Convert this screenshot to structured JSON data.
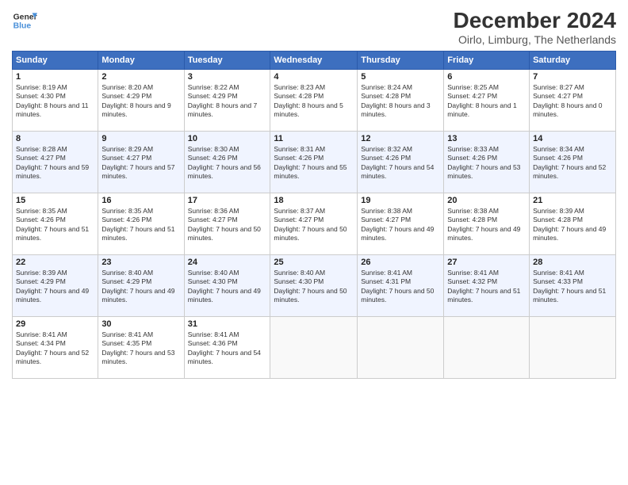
{
  "header": {
    "logo_line1": "General",
    "logo_line2": "Blue",
    "month": "December 2024",
    "location": "Oirlo, Limburg, The Netherlands"
  },
  "weekdays": [
    "Sunday",
    "Monday",
    "Tuesday",
    "Wednesday",
    "Thursday",
    "Friday",
    "Saturday"
  ],
  "weeks": [
    [
      {
        "day": "1",
        "rise": "8:19 AM",
        "set": "4:30 PM",
        "daylight": "8 hours and 11 minutes."
      },
      {
        "day": "2",
        "rise": "8:20 AM",
        "set": "4:29 PM",
        "daylight": "8 hours and 9 minutes."
      },
      {
        "day": "3",
        "rise": "8:22 AM",
        "set": "4:29 PM",
        "daylight": "8 hours and 7 minutes."
      },
      {
        "day": "4",
        "rise": "8:23 AM",
        "set": "4:28 PM",
        "daylight": "8 hours and 5 minutes."
      },
      {
        "day": "5",
        "rise": "8:24 AM",
        "set": "4:28 PM",
        "daylight": "8 hours and 3 minutes."
      },
      {
        "day": "6",
        "rise": "8:25 AM",
        "set": "4:27 PM",
        "daylight": "8 hours and 1 minute."
      },
      {
        "day": "7",
        "rise": "8:27 AM",
        "set": "4:27 PM",
        "daylight": "8 hours and 0 minutes."
      }
    ],
    [
      {
        "day": "8",
        "rise": "8:28 AM",
        "set": "4:27 PM",
        "daylight": "7 hours and 59 minutes."
      },
      {
        "day": "9",
        "rise": "8:29 AM",
        "set": "4:27 PM",
        "daylight": "7 hours and 57 minutes."
      },
      {
        "day": "10",
        "rise": "8:30 AM",
        "set": "4:26 PM",
        "daylight": "7 hours and 56 minutes."
      },
      {
        "day": "11",
        "rise": "8:31 AM",
        "set": "4:26 PM",
        "daylight": "7 hours and 55 minutes."
      },
      {
        "day": "12",
        "rise": "8:32 AM",
        "set": "4:26 PM",
        "daylight": "7 hours and 54 minutes."
      },
      {
        "day": "13",
        "rise": "8:33 AM",
        "set": "4:26 PM",
        "daylight": "7 hours and 53 minutes."
      },
      {
        "day": "14",
        "rise": "8:34 AM",
        "set": "4:26 PM",
        "daylight": "7 hours and 52 minutes."
      }
    ],
    [
      {
        "day": "15",
        "rise": "8:35 AM",
        "set": "4:26 PM",
        "daylight": "7 hours and 51 minutes."
      },
      {
        "day": "16",
        "rise": "8:35 AM",
        "set": "4:26 PM",
        "daylight": "7 hours and 51 minutes."
      },
      {
        "day": "17",
        "rise": "8:36 AM",
        "set": "4:27 PM",
        "daylight": "7 hours and 50 minutes."
      },
      {
        "day": "18",
        "rise": "8:37 AM",
        "set": "4:27 PM",
        "daylight": "7 hours and 50 minutes."
      },
      {
        "day": "19",
        "rise": "8:38 AM",
        "set": "4:27 PM",
        "daylight": "7 hours and 49 minutes."
      },
      {
        "day": "20",
        "rise": "8:38 AM",
        "set": "4:28 PM",
        "daylight": "7 hours and 49 minutes."
      },
      {
        "day": "21",
        "rise": "8:39 AM",
        "set": "4:28 PM",
        "daylight": "7 hours and 49 minutes."
      }
    ],
    [
      {
        "day": "22",
        "rise": "8:39 AM",
        "set": "4:29 PM",
        "daylight": "7 hours and 49 minutes."
      },
      {
        "day": "23",
        "rise": "8:40 AM",
        "set": "4:29 PM",
        "daylight": "7 hours and 49 minutes."
      },
      {
        "day": "24",
        "rise": "8:40 AM",
        "set": "4:30 PM",
        "daylight": "7 hours and 49 minutes."
      },
      {
        "day": "25",
        "rise": "8:40 AM",
        "set": "4:30 PM",
        "daylight": "7 hours and 50 minutes."
      },
      {
        "day": "26",
        "rise": "8:41 AM",
        "set": "4:31 PM",
        "daylight": "7 hours and 50 minutes."
      },
      {
        "day": "27",
        "rise": "8:41 AM",
        "set": "4:32 PM",
        "daylight": "7 hours and 51 minutes."
      },
      {
        "day": "28",
        "rise": "8:41 AM",
        "set": "4:33 PM",
        "daylight": "7 hours and 51 minutes."
      }
    ],
    [
      {
        "day": "29",
        "rise": "8:41 AM",
        "set": "4:34 PM",
        "daylight": "7 hours and 52 minutes."
      },
      {
        "day": "30",
        "rise": "8:41 AM",
        "set": "4:35 PM",
        "daylight": "7 hours and 53 minutes."
      },
      {
        "day": "31",
        "rise": "8:41 AM",
        "set": "4:36 PM",
        "daylight": "7 hours and 54 minutes."
      },
      null,
      null,
      null,
      null
    ]
  ],
  "label_sunrise": "Sunrise:",
  "label_sunset": "Sunset:",
  "label_daylight": "Daylight:"
}
